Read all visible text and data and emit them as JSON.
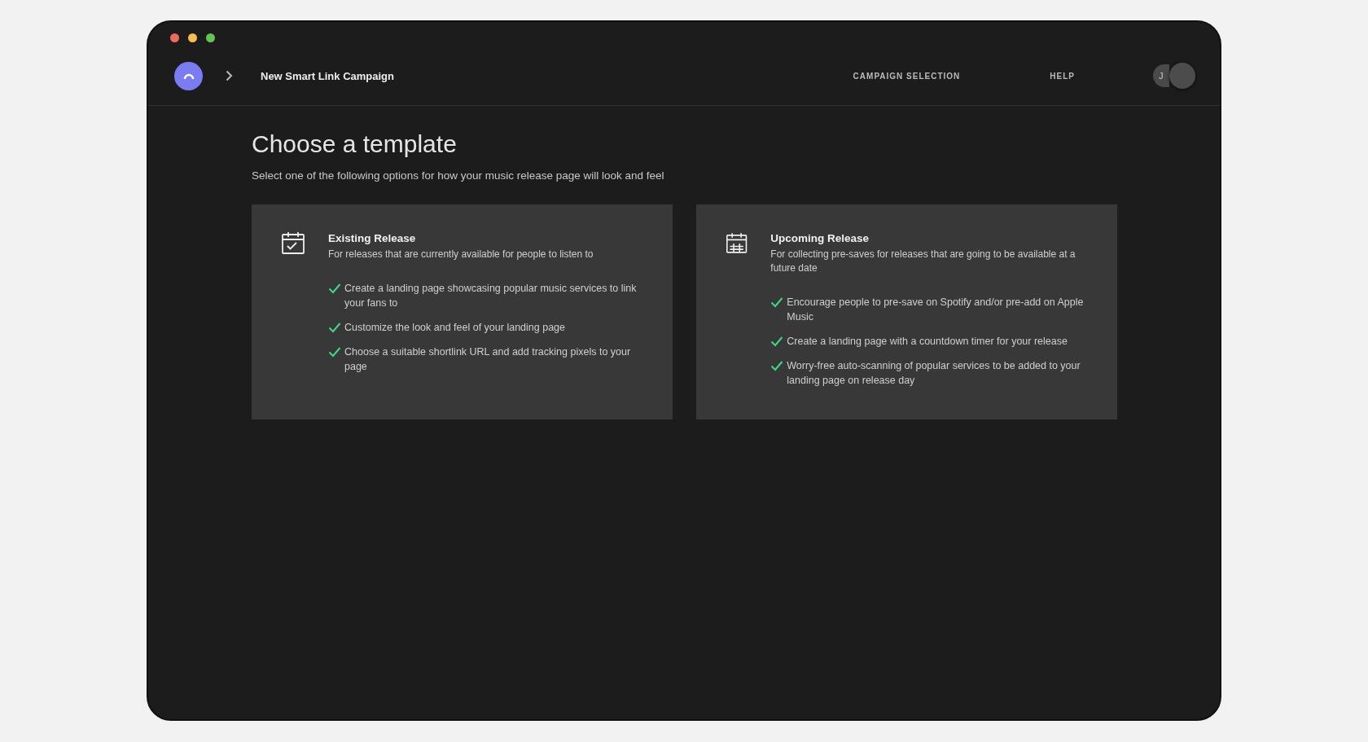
{
  "window": {
    "controls": [
      {
        "color": "#ed6a5e"
      },
      {
        "color": "#f5bf4f"
      },
      {
        "color": "#61c554"
      }
    ]
  },
  "header": {
    "title": "New Smart Link Campaign",
    "nav": [
      "CAMPAIGN SELECTION",
      "HELP"
    ],
    "avatar_initials": "J"
  },
  "heading": "Choose a template",
  "subtitle": "Select one of the following options for how your music release page will look and feel",
  "templates": [
    {
      "kind": "existing",
      "title": "Existing Release",
      "description": "For releases that are currently available for people to listen to",
      "features": [
        "Create a landing page showcasing popular music services to link your fans to",
        "Customize the look and feel of your landing page",
        "Choose a suitable shortlink URL and add tracking pixels to your page"
      ]
    },
    {
      "kind": "upcoming",
      "title": "Upcoming Release",
      "description": "For collecting pre-saves for releases that are going to be available at a future date",
      "features": [
        "Encourage people to pre-save on Spotify and/or pre-add on Apple Music",
        "Create a landing page with a countdown timer for your release",
        "Worry-free auto-scanning of popular services to be added to your landing page on release day"
      ]
    }
  ]
}
